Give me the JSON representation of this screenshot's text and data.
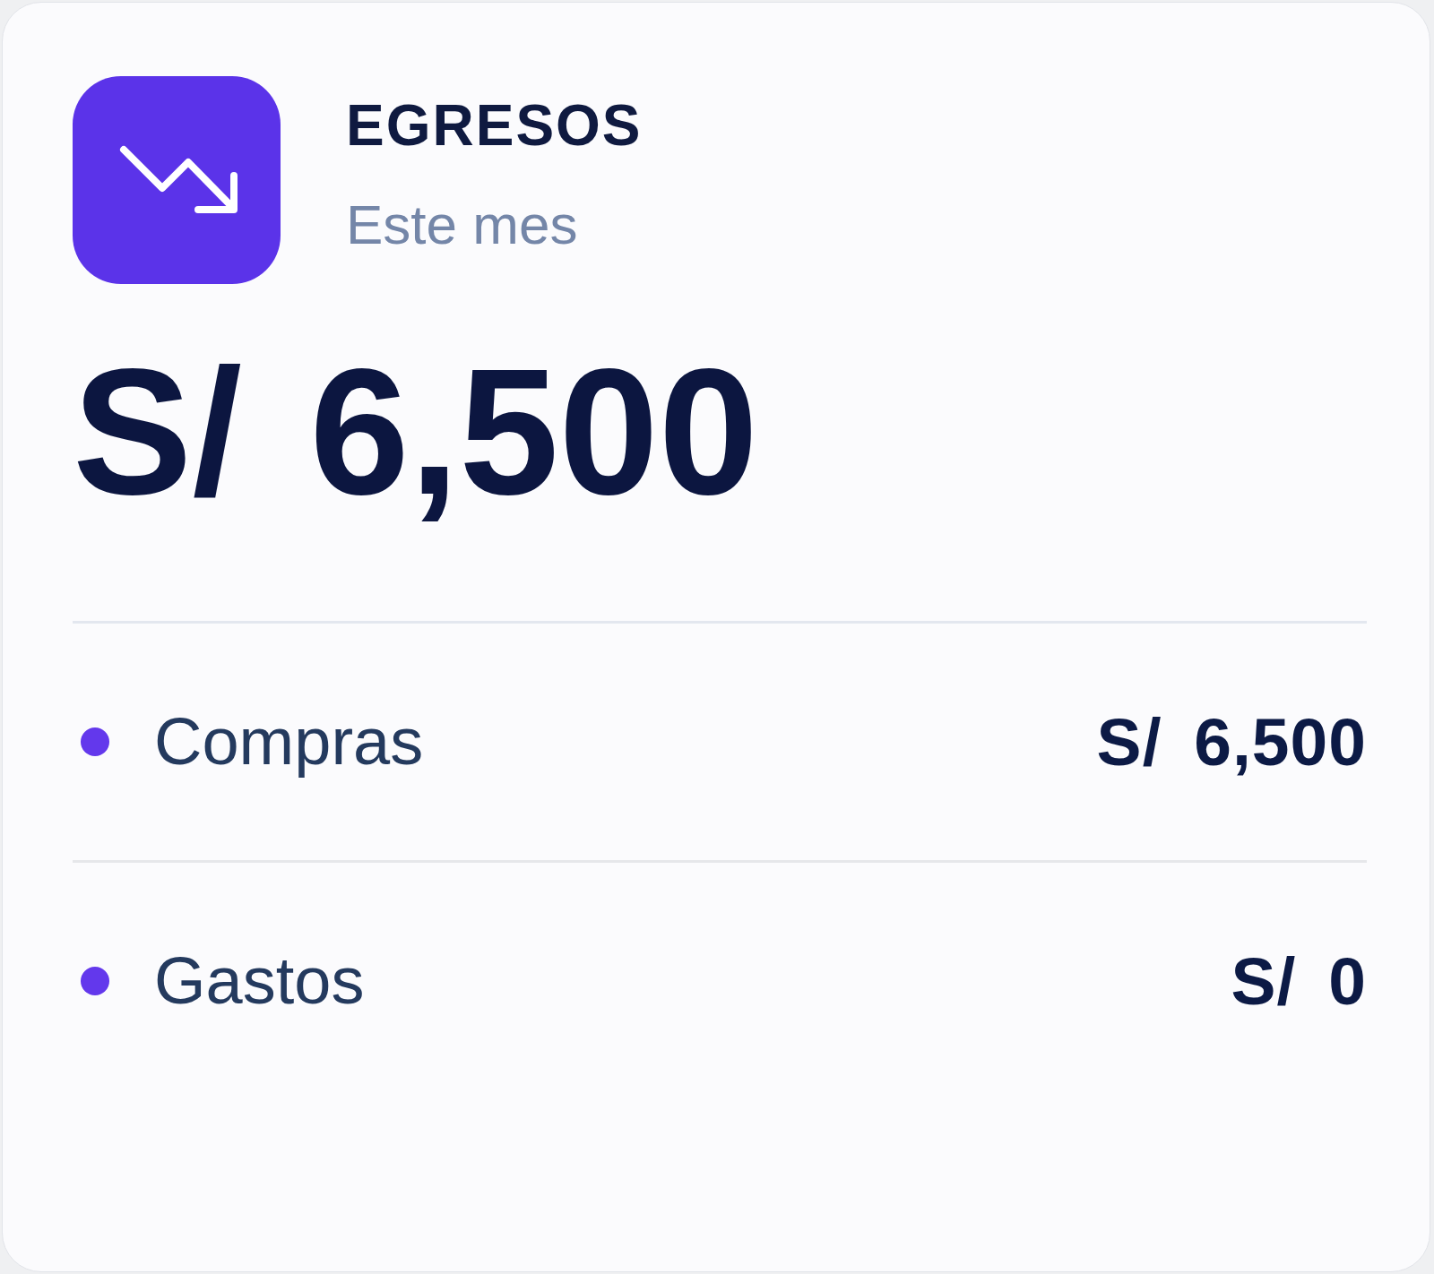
{
  "card": {
    "title": "EGRESOS",
    "subtitle": "Este mes",
    "total": "S/ 6,500"
  },
  "breakdown": [
    {
      "label": "Compras",
      "amount": "S/ 6,500"
    },
    {
      "label": "Gastos",
      "amount": "S/ 0"
    }
  ]
}
